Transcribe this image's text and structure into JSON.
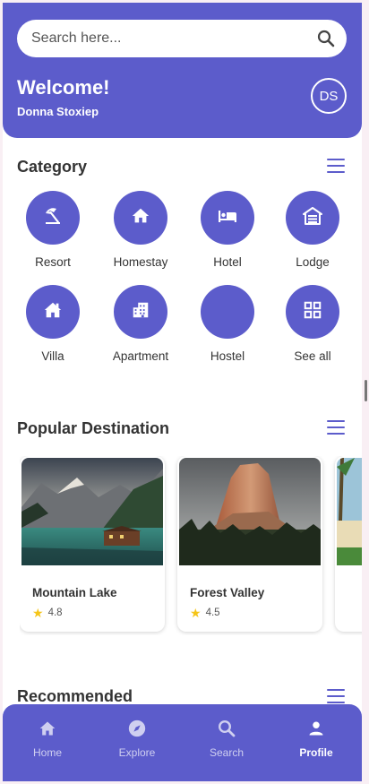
{
  "search": {
    "placeholder": "Search here..."
  },
  "header": {
    "welcome": "Welcome!",
    "username": "Donna Stoxiep",
    "avatar_initials": "DS"
  },
  "category": {
    "title": "Category",
    "items": [
      {
        "label": "Resort",
        "icon": "beach-umbrella-icon"
      },
      {
        "label": "Homestay",
        "icon": "home-icon"
      },
      {
        "label": "Hotel",
        "icon": "bed-icon"
      },
      {
        "label": "Lodge",
        "icon": "lodge-icon"
      },
      {
        "label": "Villa",
        "icon": "villa-icon"
      },
      {
        "label": "Apartment",
        "icon": "apartment-icon"
      },
      {
        "label": "Hostel",
        "icon": ""
      },
      {
        "label": "See all",
        "icon": "grid-icon"
      }
    ]
  },
  "popular": {
    "title": "Popular Destination",
    "cards": [
      {
        "name": "Mountain Lake",
        "rating": "4.8"
      },
      {
        "name": "Forest Valley",
        "rating": "4.5"
      }
    ]
  },
  "recommended": {
    "title": "Recommended"
  },
  "nav": {
    "items": [
      {
        "label": "Home",
        "icon": "home-icon",
        "active": false
      },
      {
        "label": "Explore",
        "icon": "compass-icon",
        "active": false
      },
      {
        "label": "Search",
        "icon": "search-icon",
        "active": false
      },
      {
        "label": "Profile",
        "icon": "person-icon",
        "active": true
      }
    ]
  },
  "colors": {
    "primary": "#5c5ccb",
    "star": "#f5c518",
    "background": "#f9eff4"
  }
}
